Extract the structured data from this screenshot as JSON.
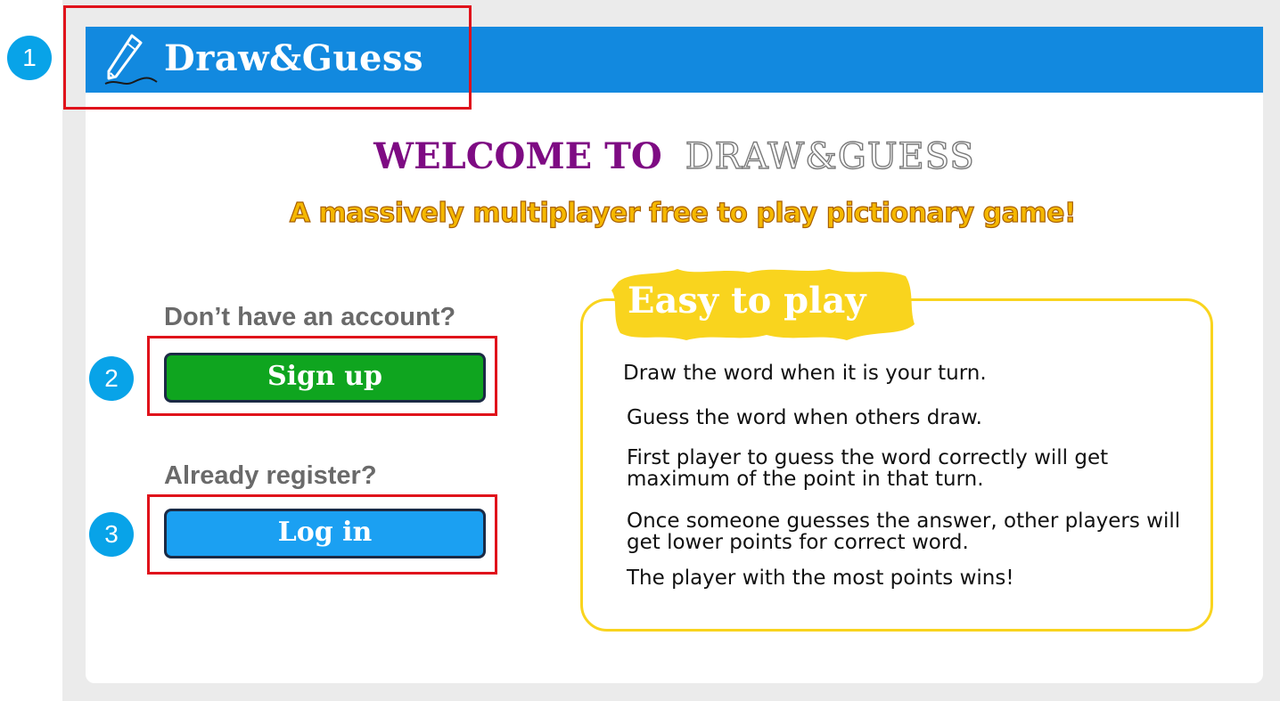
{
  "header": {
    "brand": "Draw&Guess",
    "brand_icon": "pencil-icon",
    "color": "#1289df"
  },
  "hero": {
    "welcome_prefix": "WELCOME TO",
    "welcome_name": "DRAW&GUESS",
    "tagline": "A massively multiplayer free to play pictionary game!"
  },
  "auth": {
    "signup_prompt": "Don’t have an account?",
    "signup_button": "Sign up",
    "login_prompt": "Already register?",
    "login_button": "Log in",
    "signup_color": "#0fa51f",
    "login_color": "#1ba0f2"
  },
  "info": {
    "title": "Easy to play",
    "lines": [
      "Draw the word when it is your turn.",
      "Guess the word when others draw.",
      "First player to guess the word correctly will get maximum of the point in that turn.",
      "Once someone guesses the answer, other players will get lower points for correct word.",
      "The player with the most points wins!"
    ],
    "accent": "#f9d41e"
  },
  "annotations": {
    "markers": [
      "1",
      "2",
      "3"
    ],
    "highlight_color": "#e0121b",
    "marker_color": "#08a3e8"
  }
}
